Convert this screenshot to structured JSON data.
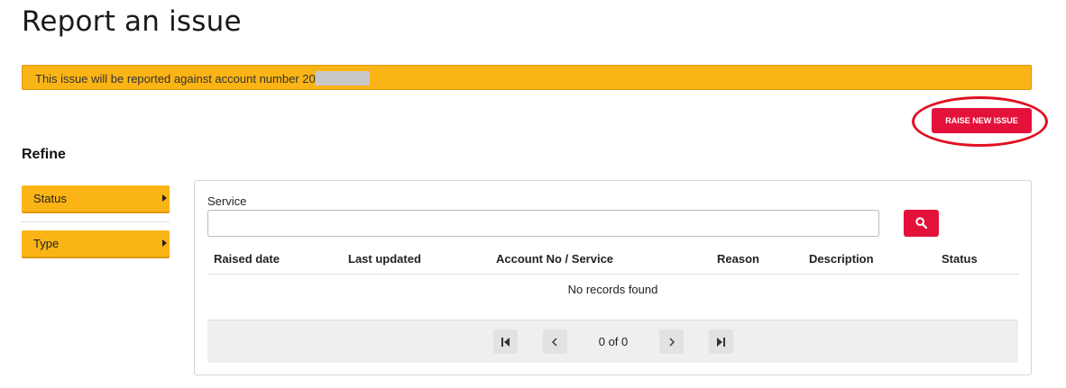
{
  "page": {
    "title": "Report an issue"
  },
  "banner": {
    "text": "This issue will be reported against account number 20"
  },
  "actions": {
    "raise_label": "RAISE NEW ISSUE"
  },
  "refine": {
    "heading": "Refine",
    "filters": [
      {
        "label": "Status"
      },
      {
        "label": "Type"
      }
    ]
  },
  "search": {
    "service_label": "Service",
    "service_value": ""
  },
  "table": {
    "columns": [
      "Raised date",
      "Last updated",
      "Account No / Service",
      "Reason",
      "Description",
      "Status"
    ],
    "rows": [],
    "empty_text": "No records found"
  },
  "pagination": {
    "info": "0 of 0"
  },
  "colors": {
    "accent_red": "#e4123b",
    "banner_yellow": "#fbb416"
  },
  "icons": [
    "search-icon",
    "first-page-icon",
    "prev-page-icon",
    "next-page-icon",
    "last-page-icon",
    "chevron-right-icon"
  ]
}
